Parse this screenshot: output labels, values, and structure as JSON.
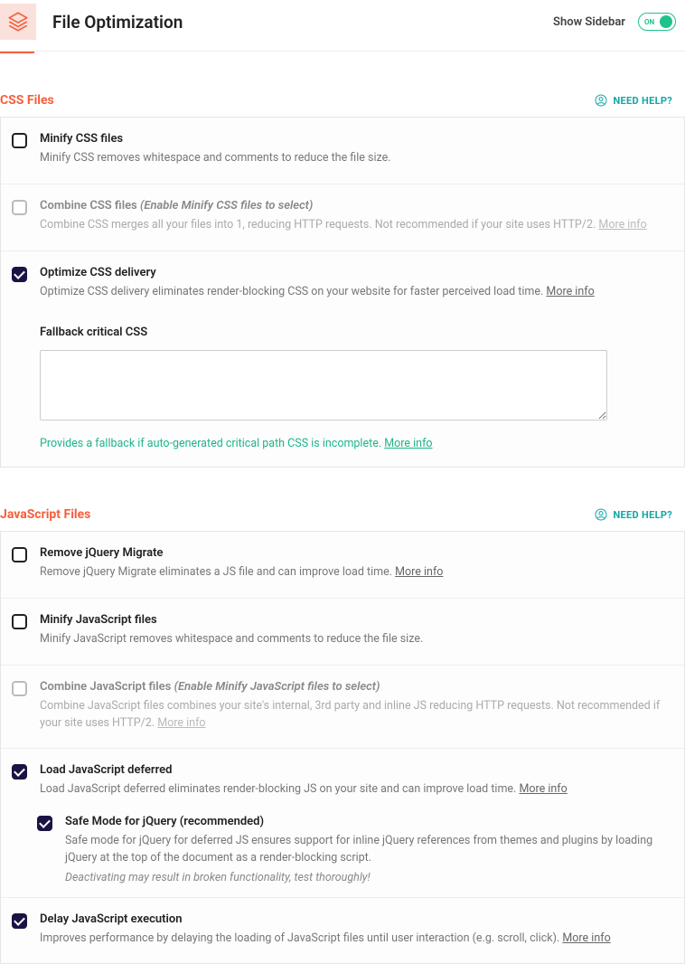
{
  "header": {
    "title": "File Optimization",
    "show_sidebar_label": "Show Sidebar",
    "toggle_text": "ON"
  },
  "help_label": "NEED HELP?",
  "more_info_label": "More info",
  "sections": {
    "css": {
      "title": "CSS Files",
      "options": {
        "minify": {
          "title": "Minify CSS files",
          "desc": "Minify CSS removes whitespace and comments to reduce the file size."
        },
        "combine": {
          "title": "Combine CSS files",
          "hint": "(Enable Minify CSS files to select)",
          "desc": "Combine CSS merges all your files into 1, reducing HTTP requests. Not recommended if your site uses HTTP/2."
        },
        "optimize": {
          "title": "Optimize CSS delivery",
          "desc": "Optimize CSS delivery eliminates render-blocking CSS on your website for faster perceived load time.",
          "fallback_label": "Fallback critical CSS",
          "fallback_note": "Provides a fallback if auto-generated critical path CSS is incomplete."
        }
      }
    },
    "js": {
      "title": "JavaScript Files",
      "options": {
        "remove_migrate": {
          "title": "Remove jQuery Migrate",
          "desc": "Remove jQuery Migrate eliminates a JS file and can improve load time."
        },
        "minify": {
          "title": "Minify JavaScript files",
          "desc": "Minify JavaScript removes whitespace and comments to reduce the file size."
        },
        "combine": {
          "title": "Combine JavaScript files",
          "hint": "(Enable Minify JavaScript files to select)",
          "desc": "Combine JavaScript files combines your site's internal, 3rd party and inline JS reducing HTTP requests. Not recommended if your site uses HTTP/2."
        },
        "defer": {
          "title": "Load JavaScript deferred",
          "desc": "Load JavaScript deferred eliminates render-blocking JS on your site and can improve load time.",
          "safe_mode": {
            "title": "Safe Mode for jQuery (recommended)",
            "desc": "Safe mode for jQuery for deferred JS ensures support for inline jQuery references from themes and plugins by loading jQuery at the top of the document as a render-blocking script.",
            "warning": "Deactivating may result in broken functionality, test thoroughly!"
          }
        },
        "delay": {
          "title": "Delay JavaScript execution",
          "desc": "Improves performance by delaying the loading of JavaScript files until user interaction (e.g. scroll, click)."
        }
      }
    }
  }
}
